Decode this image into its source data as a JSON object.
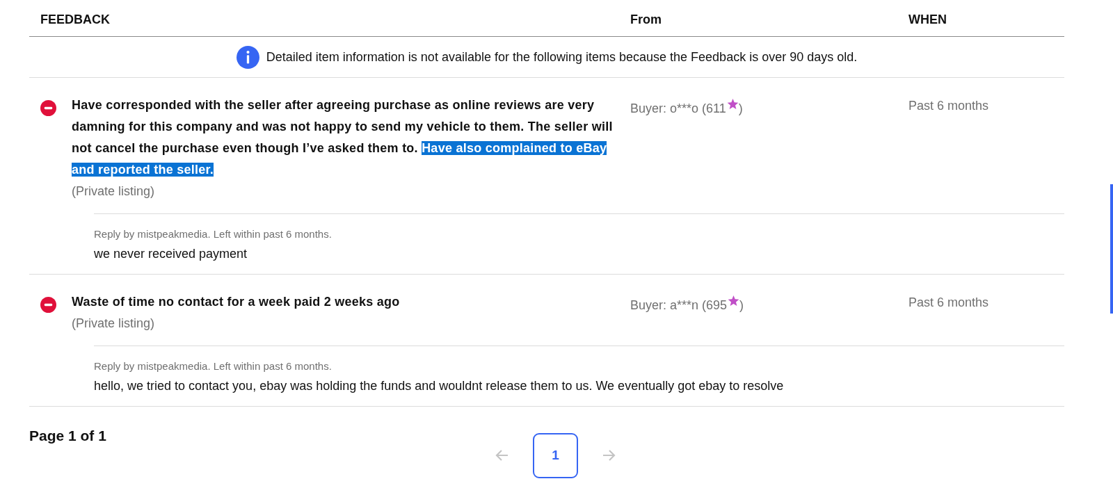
{
  "table": {
    "columns": [
      "FEEDBACK",
      "From",
      "WHEN"
    ]
  },
  "notice": {
    "text": "Detailed item information is not available for the following items because the Feedback is over 90 days old."
  },
  "entries": [
    {
      "kind": "negative",
      "comment": "Have corresponded with the seller after agreeing purchase as online reviews are very damning for this company and was not happy to send my vehicle to them. The seller will not cancel the purchase even though I’ve asked them to. ",
      "comment_selected": "Have also complained to eBay and reported the seller.",
      "listing": "(Private listing)",
      "from": "Buyer: o***o (611",
      "from_close": ")",
      "when": "Past 6 months",
      "reply": {
        "meta": "Reply by mistpeakmedia. Left within past 6 months.",
        "text": "we never received payment"
      }
    },
    {
      "kind": "negative",
      "comment": "Waste of time no contact for a week paid 2 weeks ago",
      "listing": "(Private listing)",
      "from": "Buyer: a***n (695",
      "from_close": ")",
      "when": "Past 6 months",
      "reply": {
        "meta": "Reply by mistpeakmedia. Left within past 6 months.",
        "text": "hello, we tried to contact you, ebay was holding the funds and wouldnt release them to us. We eventually got ebay to resolve"
      }
    }
  ],
  "pagination": {
    "summary": "Page 1 of 1",
    "prev": {
      "disabled": true
    },
    "pages": [
      {
        "label": "1",
        "selected": true
      }
    ],
    "next": {
      "disabled": true
    }
  }
}
